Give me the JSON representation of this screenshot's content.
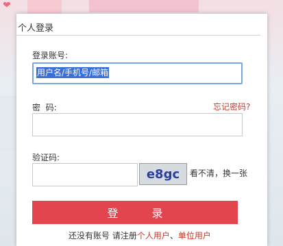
{
  "dialog": {
    "title": "个人登录",
    "account_label": "登录账号:",
    "account_value": "用户名/手机号/邮箱",
    "password_label": "密  码:",
    "forgot_password": "忘记密码?",
    "captcha_label": "验证码:",
    "captcha_text": "e8gc",
    "refresh_captcha": "看不清，换一张",
    "login_button": "登 录",
    "register_prompt": "还没有账号 请注册",
    "register_personal": "个人用户",
    "separator": "、",
    "register_unit": "单位用户"
  },
  "colors": {
    "accent": "#e2454e",
    "link": "#c0392b",
    "focus": "#79a6e4"
  }
}
